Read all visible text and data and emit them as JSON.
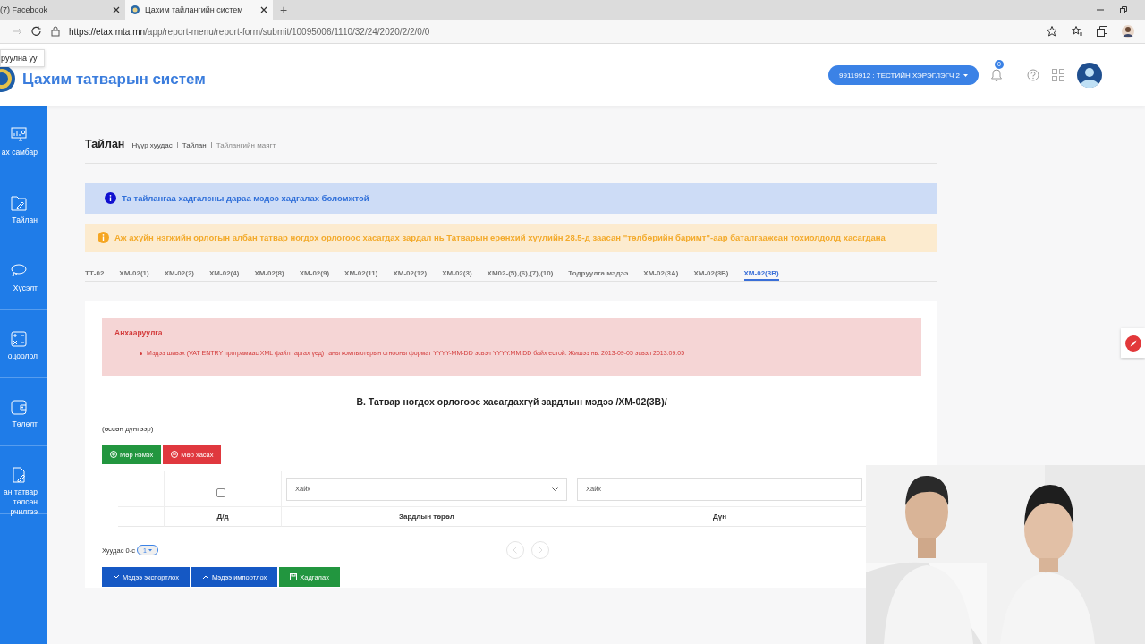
{
  "browser": {
    "tabs": [
      {
        "label": "(7) Facebook",
        "selected": false
      },
      {
        "label": "Цахим тайлангийн систем",
        "selected": true
      }
    ],
    "new_tab": "+",
    "address": {
      "host": "https://etax.mta.mn",
      "path": "/app/report-menu/report-form/submit/10095006/1110/32/24/2020/2/2/0/0"
    }
  },
  "header": {
    "title": "Цахим татварын систем",
    "tooltip": "руулна уу",
    "user_button": "99119912 : ТЕСТИЙН ХЭРЭГЛЭГЧ 2",
    "notification_count": "0"
  },
  "sidebar": {
    "items": [
      {
        "kind": "dashboard",
        "label": "ах самбар"
      },
      {
        "kind": "report",
        "label": "Тайлан"
      },
      {
        "kind": "request",
        "label": "Хүсэлт"
      },
      {
        "kind": "calc",
        "label": "оцоолол"
      },
      {
        "kind": "payment",
        "label": "Төлөлт"
      },
      {
        "kind": "document",
        "label": "ан татвар төлсөн рчилгээ"
      }
    ]
  },
  "page": {
    "title": "Тайлан",
    "breadcrumb": [
      {
        "label": "Нүүр хуудас",
        "current": false
      },
      {
        "label": "Тайлан",
        "current": false
      },
      {
        "label": "Тайлангийн маягт",
        "current": true
      }
    ],
    "alerts": [
      {
        "kind": "info",
        "text": "Та тайлангаа хадгалсны дараа мэдээ хадгалах боломжтой"
      },
      {
        "kind": "warning",
        "text": "Аж ахуйн нэгжийн орлогын албан татвар ногдох орлогоос хасагдах зардал нь Татварын ерөнхий хуулийн 28.5-д заасан \"төлбөрийн баримт\"-аар баталгаажсан тохиолдолд хасагдана"
      }
    ],
    "form_tabs": [
      {
        "label": "ТТ-02",
        "selected": false
      },
      {
        "label": "ХМ-02(1)",
        "selected": false
      },
      {
        "label": "ХМ-02(2)",
        "selected": false
      },
      {
        "label": "ХМ-02(4)",
        "selected": false
      },
      {
        "label": "ХМ-02(8)",
        "selected": false
      },
      {
        "label": "ХМ-02(9)",
        "selected": false
      },
      {
        "label": "ХМ-02(11)",
        "selected": false
      },
      {
        "label": "ХМ-02(12)",
        "selected": false
      },
      {
        "label": "ХМ-02(3)",
        "selected": false
      },
      {
        "label": "ХМ02-(5),(6),(7),(10)",
        "selected": false
      },
      {
        "label": "Тодруулга мэдээ",
        "selected": false
      },
      {
        "label": "ХМ-02(3А)",
        "selected": false
      },
      {
        "label": "ХМ-02(3Б)",
        "selected": false
      },
      {
        "label": "ХМ-02(3В)",
        "selected": true
      }
    ]
  },
  "card": {
    "notice": {
      "title": "Анхааруулга",
      "items": [
        "Мэдээ шивэх (VAT ENTRY програмаас XML файл гаргах үед) таны компьютерын огнооны формат YYYY-MM-DD эсвэл YYYY.MM.DD байх естой. Жишээ нь: 2013-09-05 эсвэл 2013.09.05"
      ]
    },
    "heading": "В. Татвар ногдох орлогоос хасагдахгүй зардлын мэдээ /ХМ-02(3В)/",
    "note": "(өссөн дүнгээр)",
    "row_buttons": [
      {
        "kind": "add",
        "label": "Мөр нэмэх"
      },
      {
        "kind": "remove",
        "label": "Мөр хасах"
      }
    ],
    "table": {
      "select_all_checked": false,
      "filters": [
        {
          "kind": "select",
          "placeholder": "Хайх"
        },
        {
          "kind": "input",
          "placeholder": "Хайх"
        }
      ],
      "columns": [
        "Д/д",
        "Зардлын төрөл",
        "Дүн"
      ]
    },
    "pagination": {
      "label": "Хуудас 0-с",
      "page": "1"
    },
    "actions": [
      {
        "kind": "export",
        "label": "Мэдээ экспортлох"
      },
      {
        "kind": "import",
        "label": "Мэдээ импортлох"
      },
      {
        "kind": "save",
        "label": "Хадгалах"
      }
    ]
  }
}
